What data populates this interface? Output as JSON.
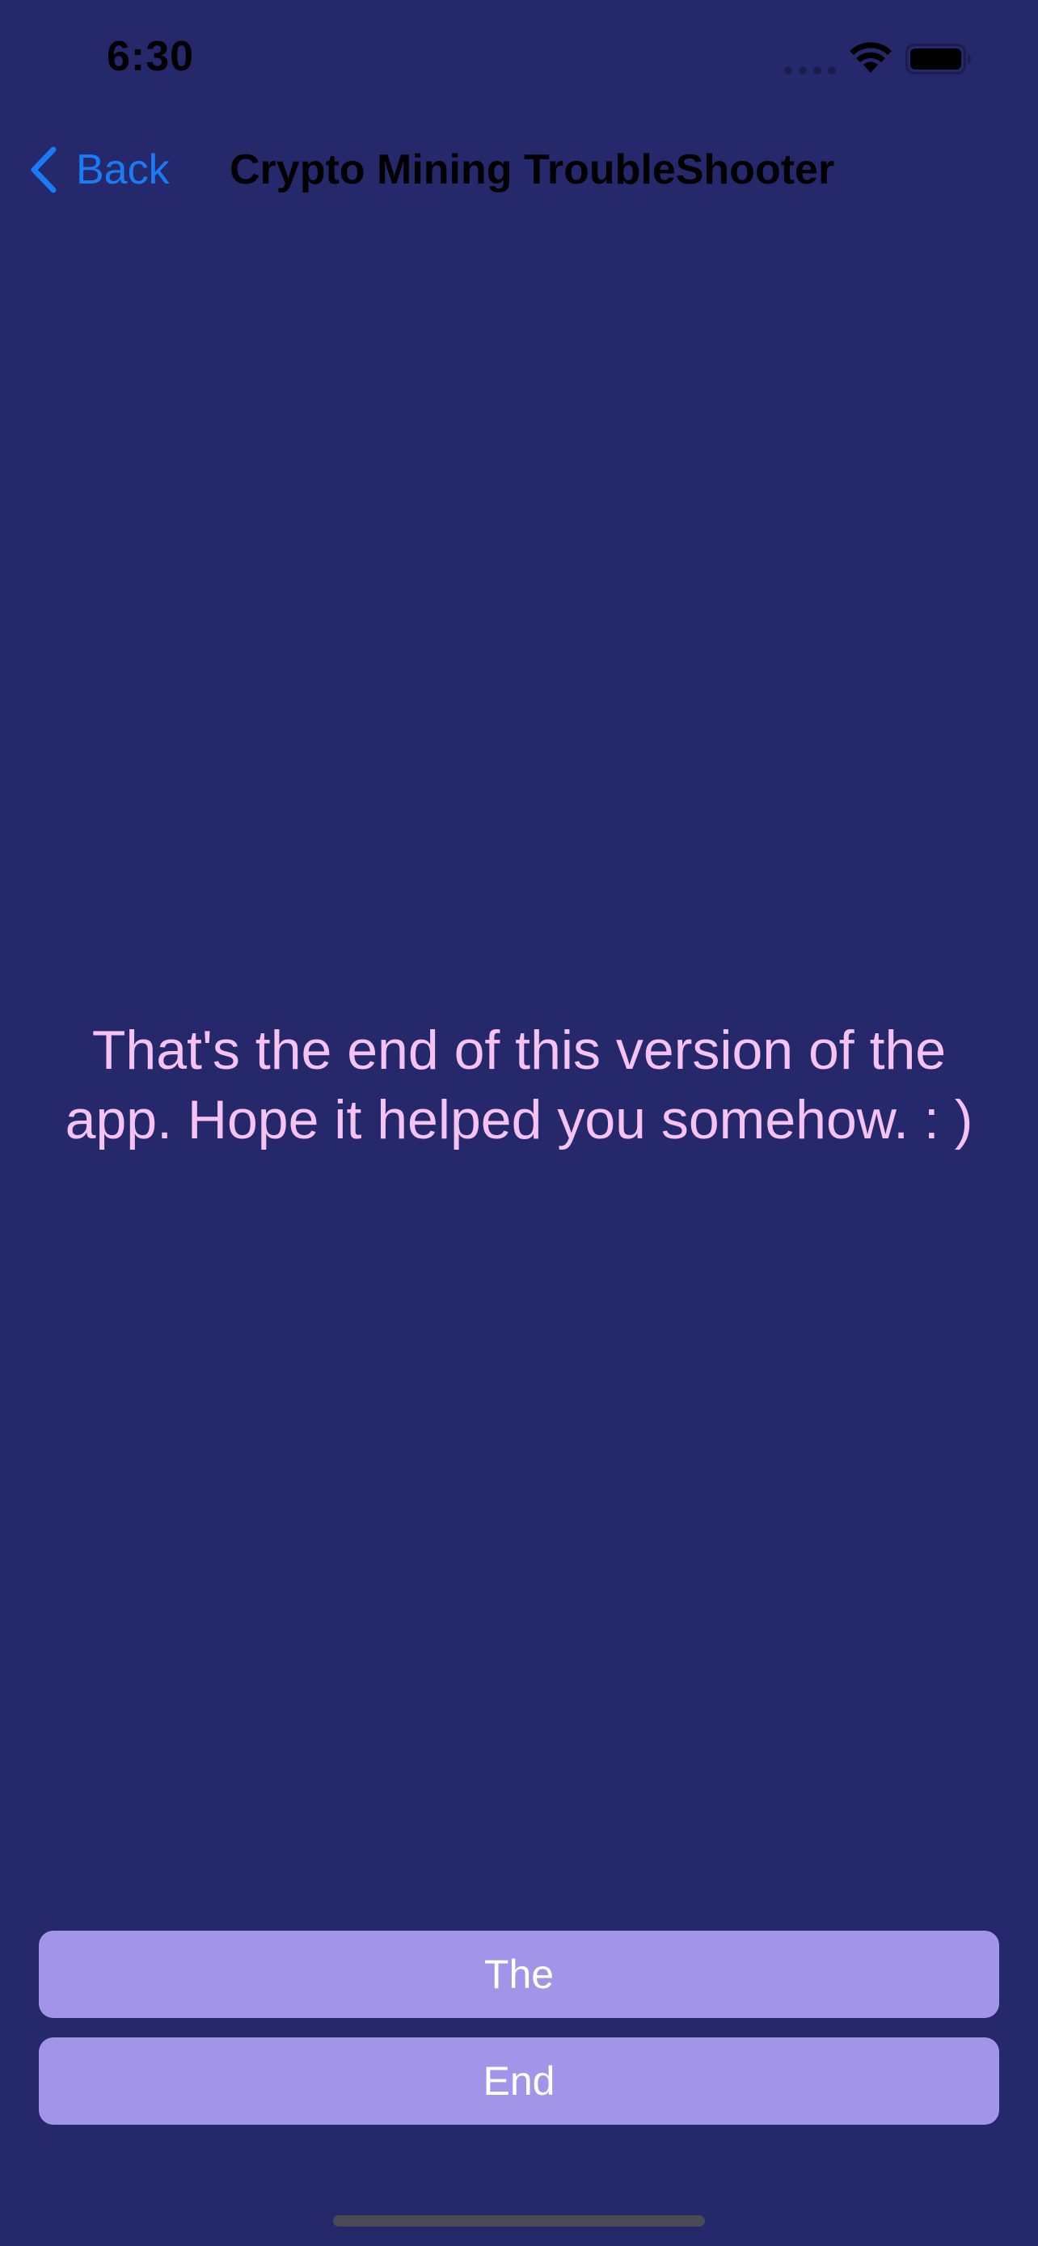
{
  "status_bar": {
    "time": "6:30",
    "signal_icon": "cellular-signal-icon",
    "wifi_icon": "wifi-icon",
    "battery_icon": "battery-full-icon"
  },
  "nav": {
    "back_label": "Back",
    "back_icon": "chevron-left-icon",
    "title": "Crypto Mining TroubleShooter"
  },
  "main": {
    "message": "That's the end of this version of the app. Hope it helped you somehow. : )"
  },
  "buttons": {
    "first_label": "The",
    "second_label": "End"
  },
  "colors": {
    "background": "#25286b",
    "accent": "#1a7cf5",
    "message_text": "#f6c2f1",
    "button_fill": "#a194e9",
    "button_text": "#ffffff"
  }
}
